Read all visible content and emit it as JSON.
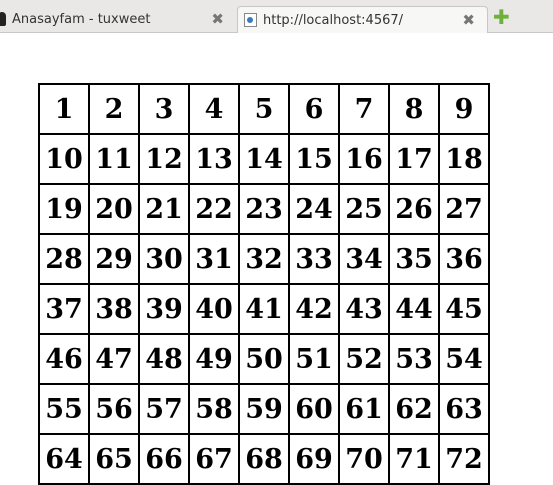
{
  "browser": {
    "tabs": [
      {
        "title": "Anasayfam - tuxweet",
        "icon": "penguin-icon",
        "active": false
      },
      {
        "title": "http://localhost:4567/",
        "icon": "page-icon",
        "active": true
      }
    ],
    "new_tab_icon": "plus-icon",
    "close_icon": "close-icon"
  },
  "table": {
    "rows": [
      [
        "1",
        "2",
        "3",
        "4",
        "5",
        "6",
        "7",
        "8",
        "9"
      ],
      [
        "10",
        "11",
        "12",
        "13",
        "14",
        "15",
        "16",
        "17",
        "18"
      ],
      [
        "19",
        "20",
        "21",
        "22",
        "23",
        "24",
        "25",
        "26",
        "27"
      ],
      [
        "28",
        "29",
        "30",
        "31",
        "32",
        "33",
        "34",
        "35",
        "36"
      ],
      [
        "37",
        "38",
        "39",
        "40",
        "41",
        "42",
        "43",
        "44",
        "45"
      ],
      [
        "46",
        "47",
        "48",
        "49",
        "50",
        "51",
        "52",
        "53",
        "54"
      ],
      [
        "55",
        "56",
        "57",
        "58",
        "59",
        "60",
        "61",
        "62",
        "63"
      ],
      [
        "64",
        "65",
        "66",
        "67",
        "68",
        "69",
        "70",
        "71",
        "72"
      ]
    ]
  }
}
